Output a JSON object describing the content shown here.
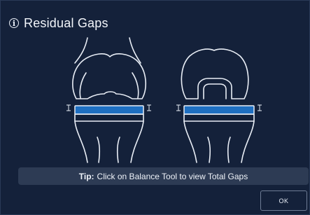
{
  "dialog": {
    "title": "Residual Gaps",
    "tip_label": "Tip:",
    "tip_text": "Click on Balance Tool to view Total Gaps",
    "ok_label": "OK"
  },
  "icons": {
    "header": "info-icon"
  },
  "colors": {
    "background": "#14213a",
    "gap_bar": "#1e6fc1",
    "outline": "#e9eef6",
    "tip_bar": "#2d3b54"
  }
}
